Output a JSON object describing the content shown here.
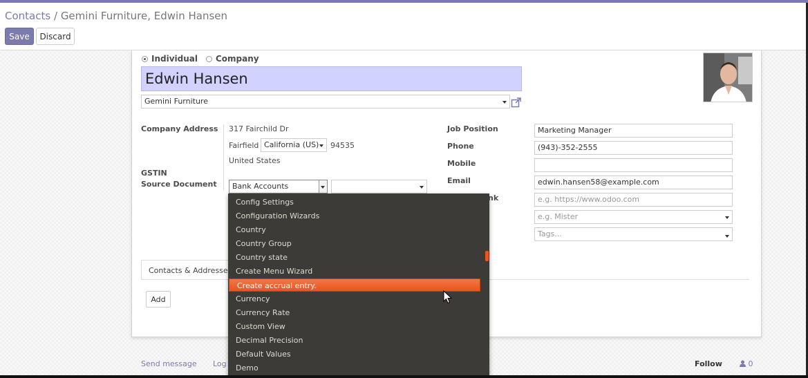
{
  "colors": {
    "accent": "#7c7bad",
    "name_field_bg": "#d2d2ff",
    "dropdown_bg": "#3c3b37",
    "dropdown_highlight": "#e95420"
  },
  "breadcrumb": {
    "root": "Contacts",
    "separator": "/",
    "current": "Gemini Furniture, Edwin Hansen"
  },
  "buttons": {
    "save": "Save",
    "discard": "Discard",
    "add": "Add"
  },
  "form": {
    "type_individual": "Individual",
    "type_company": "Company",
    "selected_type": "Individual",
    "name": "Edwin Hansen",
    "company": "Gemini Furniture",
    "labels": {
      "company_address": "Company Address",
      "gstin": "GSTIN",
      "source_document": "Source Document",
      "job_position": "Job Position",
      "phone": "Phone",
      "mobile": "Mobile",
      "email": "Email",
      "website_partial": "nk"
    },
    "address": {
      "street": "317 Fairchild Dr",
      "city": "Fairfield",
      "state": "California (US)",
      "zip": "94535",
      "country": "United States"
    },
    "source_document_model": "Bank Accounts",
    "source_document_record": "",
    "job_position": "Marketing Manager",
    "phone": "(943)-352-2555",
    "mobile": "",
    "email": "edwin.hansen58@example.com",
    "website_placeholder": "e.g. https://www.odoo.com",
    "title_placeholder": "e.g. Mister",
    "tags_placeholder": "Tags..."
  },
  "tabs": {
    "contacts_addresses": "Contacts & Addresses"
  },
  "dropdown": {
    "items": [
      "Config Settings",
      "Configuration Wizards",
      "Country",
      "Country Group",
      "Country state",
      "Create Menu Wizard",
      "Create accrual entry.",
      "Currency",
      "Currency Rate",
      "Custom View",
      "Decimal Precision",
      "Default Values",
      "Demo"
    ],
    "selected_index": 6
  },
  "chatter": {
    "send_message": "Send message",
    "log_note_partial": "Log",
    "follow": "Follow",
    "followers_count": "0"
  }
}
